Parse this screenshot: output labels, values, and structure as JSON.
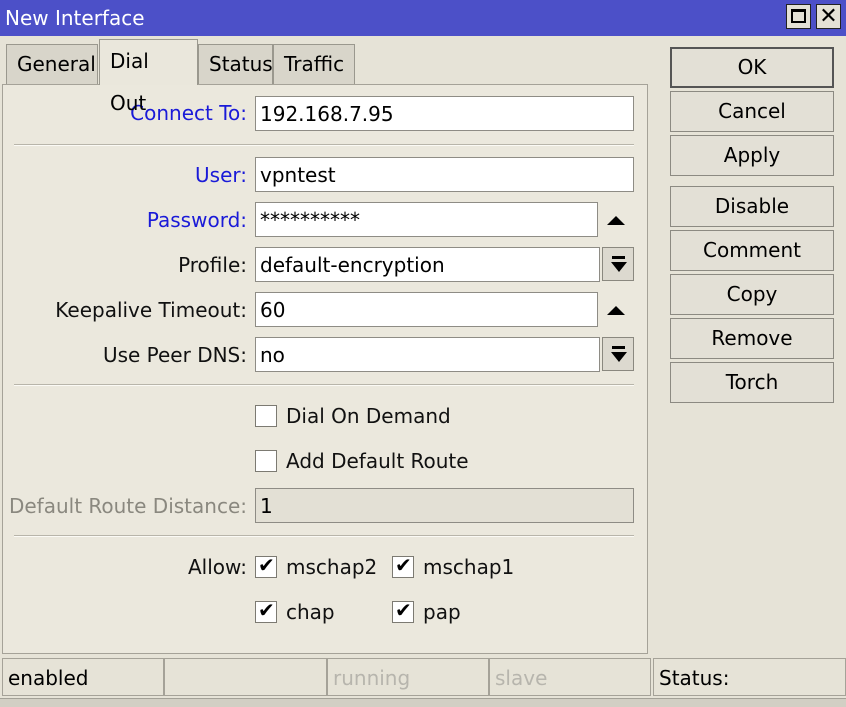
{
  "window": {
    "title": "New Interface"
  },
  "tabs": [
    "General",
    "Dial Out",
    "Status",
    "Traffic"
  ],
  "fields": {
    "connect_to": {
      "label": "Connect To:",
      "value": "192.168.7.95"
    },
    "user": {
      "label": "User:",
      "value": "vpntest"
    },
    "password": {
      "label": "Password:",
      "value": "**********"
    },
    "profile": {
      "label": "Profile:",
      "value": "default-encryption"
    },
    "keepalive": {
      "label": "Keepalive Timeout:",
      "value": "60"
    },
    "use_peer_dns": {
      "label": "Use Peer DNS:",
      "value": "no"
    },
    "default_route_distance": {
      "label": "Default Route Distance:",
      "value": "1"
    }
  },
  "checkboxes": {
    "dial_on_demand": {
      "label": "Dial On Demand",
      "checked": false
    },
    "add_default_route": {
      "label": "Add Default Route",
      "checked": false
    }
  },
  "allow": {
    "label": "Allow:",
    "mschap2": {
      "label": "mschap2",
      "checked": true
    },
    "mschap1": {
      "label": "mschap1",
      "checked": true
    },
    "chap": {
      "label": "chap",
      "checked": true
    },
    "pap": {
      "label": "pap",
      "checked": true
    }
  },
  "buttons": {
    "ok": "OK",
    "cancel": "Cancel",
    "apply": "Apply",
    "disable": "Disable",
    "comment": "Comment",
    "copy": "Copy",
    "remove": "Remove",
    "torch": "Torch"
  },
  "status_bar": {
    "enabled": "enabled",
    "empty": "",
    "running": "running",
    "slave": "slave",
    "status": "Status:"
  },
  "icons": {
    "check": "✔",
    "close": "✕"
  },
  "colors": {
    "titlebar": "#4c50c8",
    "required_label": "#1a1ad8"
  }
}
